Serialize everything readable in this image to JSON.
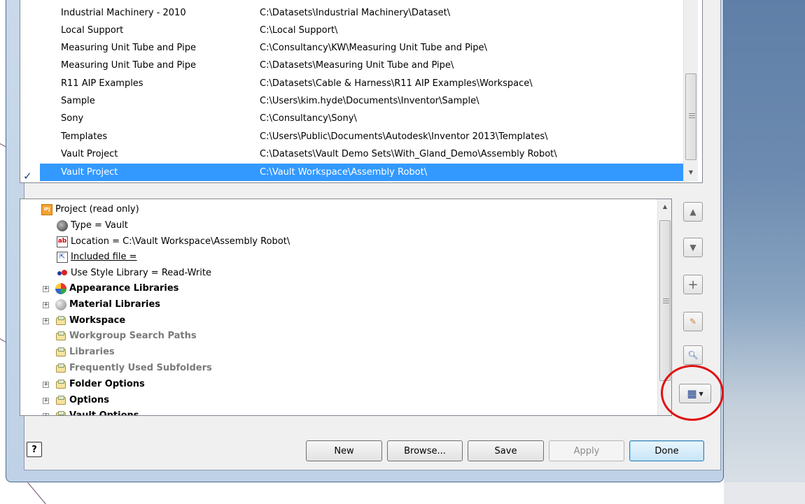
{
  "projects": [
    {
      "name": "Industrial Machinery - 2010",
      "path": "C:\\Datasets\\Industrial Machinery\\Dataset\\"
    },
    {
      "name": "Local Support",
      "path": "C:\\Local Support\\"
    },
    {
      "name": "Measuring Unit Tube and Pipe",
      "path": "C:\\Consultancy\\KW\\Measuring Unit Tube and Pipe\\"
    },
    {
      "name": "Measuring Unit Tube and Pipe",
      "path": "C:\\Datasets\\Measuring Unit Tube and Pipe\\"
    },
    {
      "name": "R11 AIP Examples",
      "path": "C:\\Datasets\\Cable & Harness\\R11 AIP Examples\\Workspace\\"
    },
    {
      "name": "Sample",
      "path": "C:\\Users\\kim.hyde\\Documents\\Inventor\\Sample\\"
    },
    {
      "name": "Sony",
      "path": "C:\\Consultancy\\Sony\\"
    },
    {
      "name": "Templates",
      "path": "C:\\Users\\Public\\Documents\\Autodesk\\Inventor 2013\\Templates\\"
    },
    {
      "name": "Vault Project",
      "path": "C:\\Datasets\\Vault Demo Sets\\With_Gland_Demo\\Assembly Robot\\"
    },
    {
      "name": "Vault Project",
      "path": "C:\\Vault Workspace\\Assembly Robot\\",
      "selected": true
    }
  ],
  "active_mark": "✓",
  "tree": {
    "root": "Project (read only)",
    "type": "Type = Vault",
    "location": "Location = C:\\Vault Workspace\\Assembly Robot\\",
    "included": "Included file =",
    "style_library": "Use Style Library = Read-Write",
    "appearance": "Appearance Libraries",
    "material": "Material Libraries",
    "workspace": "Workspace",
    "workgroup": "Workgroup Search Paths",
    "libraries": "Libraries",
    "frequent": "Frequently Used Subfolders",
    "folder_options": "Folder Options",
    "options": "Options",
    "vault_options": "Vault Options"
  },
  "buttons": {
    "help": "?",
    "new": "New",
    "browse": "Browse...",
    "save": "Save",
    "apply": "Apply",
    "done": "Done"
  },
  "side_buttons": [
    "move-up",
    "move-down",
    "add",
    "edit",
    "find",
    "options-menu"
  ],
  "colors": {
    "selection": "#3399ff",
    "highlight_circle": "#e01212",
    "window_frame": "#bed1e6"
  }
}
